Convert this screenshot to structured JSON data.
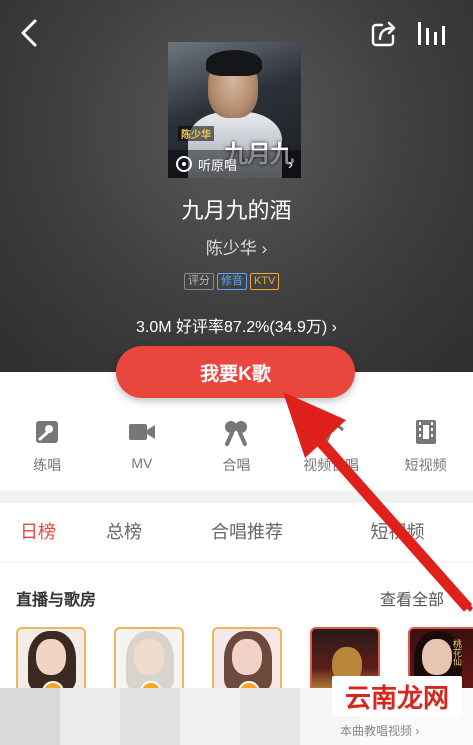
{
  "header": {
    "back_icon": "chevron-left-icon",
    "share_icon": "share-icon",
    "chart_icon": "bar-chart-icon"
  },
  "song": {
    "cover_artist_text": "陈少华",
    "cover_title_text": "九月九",
    "listen_label": "听原唱",
    "title": "九月九的酒",
    "artist": "陈少华 ›",
    "tags": [
      "评分",
      "修音",
      "KTV"
    ],
    "stats": "3.0M  好评率87.2%(34.9万) ›"
  },
  "primary_action": {
    "label": "我要K歌"
  },
  "actions": [
    {
      "label": "练唱",
      "icon": "practice-icon"
    },
    {
      "label": "MV",
      "icon": "video-camera-icon"
    },
    {
      "label": "合唱",
      "icon": "duet-icon"
    },
    {
      "label": "视频合唱",
      "icon": "video-duet-icon"
    },
    {
      "label": "短视频",
      "icon": "short-video-icon"
    }
  ],
  "tabs": [
    {
      "label": "日榜",
      "active": true
    },
    {
      "label": "总榜",
      "active": false
    },
    {
      "label": "合唱推荐",
      "active": false
    },
    {
      "label": "短视频",
      "active": false
    }
  ],
  "live_section": {
    "title": "直播与歌房",
    "more": "查看全部"
  },
  "room_text": "桃花仙",
  "bottom_text": "本曲教唱视频 ›",
  "watermark": "云南龙网",
  "colors": {
    "accent": "#e9473e",
    "tag_blue": "#5aa3ff",
    "tag_orange": "#f0a830",
    "room_border": "#f0b45a"
  }
}
